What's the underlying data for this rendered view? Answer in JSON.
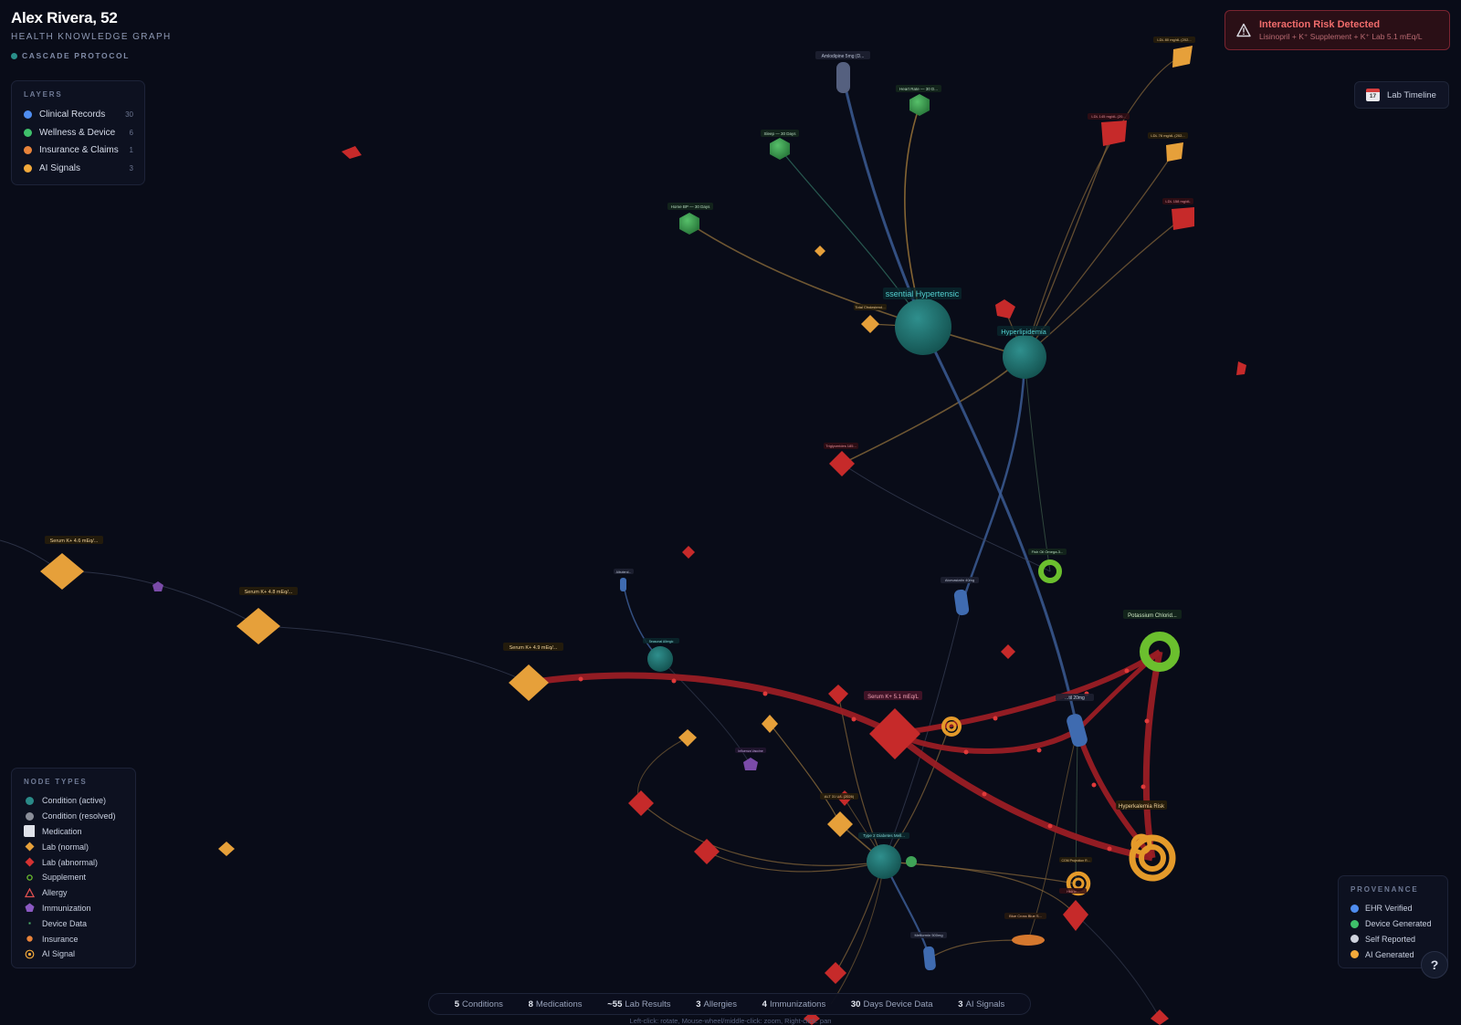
{
  "header": {
    "patient_name": "Alex Rivera, 52",
    "subtitle": "HEALTH KNOWLEDGE GRAPH",
    "protocol": "CASCADE PROTOCOL"
  },
  "layers": {
    "title": "LAYERS",
    "items": [
      {
        "label": "Clinical Records",
        "count": "30",
        "color": "#4f8df0"
      },
      {
        "label": "Wellness & Device",
        "count": "6",
        "color": "#3fc06b"
      },
      {
        "label": "Insurance & Claims",
        "count": "1",
        "color": "#e8833a"
      },
      {
        "label": "AI Signals",
        "count": "3",
        "color": "#f2a93b"
      }
    ]
  },
  "node_types": {
    "title": "NODE TYPES",
    "items": [
      {
        "label": "Condition (active)",
        "icon": "circle-teal-icon"
      },
      {
        "label": "Condition (resolved)",
        "icon": "circle-gray-icon"
      },
      {
        "label": "Medication",
        "icon": "square-white-icon"
      },
      {
        "label": "Lab (normal)",
        "icon": "diamond-orange-icon"
      },
      {
        "label": "Lab (abnormal)",
        "icon": "diamond-red-icon"
      },
      {
        "label": "Supplement",
        "icon": "ring-green-icon"
      },
      {
        "label": "Allergy",
        "icon": "triangle-red-icon"
      },
      {
        "label": "Immunization",
        "icon": "pentagon-purple-icon"
      },
      {
        "label": "Device Data",
        "icon": "dot-small-icon"
      },
      {
        "label": "Insurance",
        "icon": "dot-orange-icon"
      },
      {
        "label": "AI Signal",
        "icon": "target-orange-icon"
      }
    ]
  },
  "provenance": {
    "title": "PROVENANCE",
    "items": [
      {
        "label": "EHR Verified",
        "color": "#4f8df0"
      },
      {
        "label": "Device Generated",
        "color": "#3fc06b"
      },
      {
        "label": "Self Reported",
        "color": "#cfd3de"
      },
      {
        "label": "AI Generated",
        "color": "#f2a93b"
      }
    ]
  },
  "alert": {
    "title": "Interaction Risk Detected",
    "message": "Lisinopril + K⁺ Supplement + K⁺ Lab 5.1 mEq/L",
    "icon": "warning-triangle-icon"
  },
  "lab_timeline": {
    "label": "Lab Timeline",
    "icon": "calendar-icon",
    "day": "17"
  },
  "stats": [
    {
      "value": "5",
      "label": "Conditions"
    },
    {
      "value": "8",
      "label": "Medications"
    },
    {
      "value": "~55",
      "label": "Lab Results"
    },
    {
      "value": "3",
      "label": "Allergies"
    },
    {
      "value": "4",
      "label": "Immunizations"
    },
    {
      "value": "30",
      "label": "Days Device Data"
    },
    {
      "value": "3",
      "label": "AI Signals"
    }
  ],
  "hint": "Left-click: rotate, Mouse-wheel/middle-click: zoom, Right-click: pan",
  "help_label": "?",
  "node_labels": {
    "essential_hypertension": "ssential Hypertensic",
    "hyperlipidemia": "Hyperlipidemia",
    "amlodipine": "Amlodipine 5mg (D...",
    "heart_rate": "Heart Rate — 30 D...",
    "sleep": "Sleep — 30 Days",
    "home_bp": "Home BP — 30 Days",
    "total_cholesterol": "Total Cholesterol...",
    "ldl_80": "LDL 80 mg/dL (202...",
    "ldl_145": "LDL 145 mg/dL (20...",
    "ldl_76": "LDL 76 mg/dL (202...",
    "ldl_158": "LDL 158 mg/dL",
    "triglycerides": "Triglycerides 185...",
    "fish_oil": "Fish Oil Omega-3...",
    "potassium_chloride": "Potassium Chlorid...",
    "atorvastatin": "Atorvastatin 40mg",
    "lisinopril": "...til 20mg",
    "serum_k_46": "Serum K+ 4.6 mEq/...",
    "serum_k_48": "Serum K+ 4.8 mEq/...",
    "serum_k_49": "Serum K+ 4.9 mEq/...",
    "serum_k_51": "Serum K+ 5.1 mEq/L",
    "hyperkalemia_risk": "Hyperkalemia Risk",
    "type2_diabetes": "Type 2 Diabetes Mell...",
    "alt": "ALT 31 U/L (2026)",
    "blue_cross": "Blue Cross Blue S...",
    "metformin": "Metformin 500mg",
    "cgm_projection": "CGM Projection R...",
    "hba1c": "HbA1c...",
    "immunization_flu": "Influenza Vaccine",
    "seasonal_allergic": "Seasonal Allergic",
    "albuterol": "Albuterol..."
  }
}
